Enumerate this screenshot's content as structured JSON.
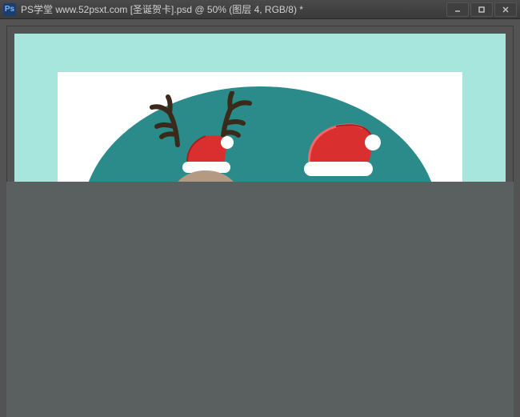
{
  "titlebar": {
    "app_icon_label": "Ps",
    "title": "PS学堂  www.52psxt.com [圣诞贺卡].psd @ 50% (图层 4,  RGB/8) *"
  },
  "window_controls": {
    "minimize": "minimize",
    "maximize": "maximize",
    "close": "close"
  },
  "document": {
    "filename": "圣诞贺卡.psd",
    "zoom": "50%",
    "layer": "图层 4",
    "color_mode": "RGB/8",
    "modified": true
  },
  "colors": {
    "canvas_bg": "#a6e6dc",
    "card_bg": "#ffffff",
    "oval_bg": "#2b8a8a",
    "hat_red": "#d92f2f",
    "hat_trim": "#ffffff",
    "antler": "#3a2a1a"
  }
}
